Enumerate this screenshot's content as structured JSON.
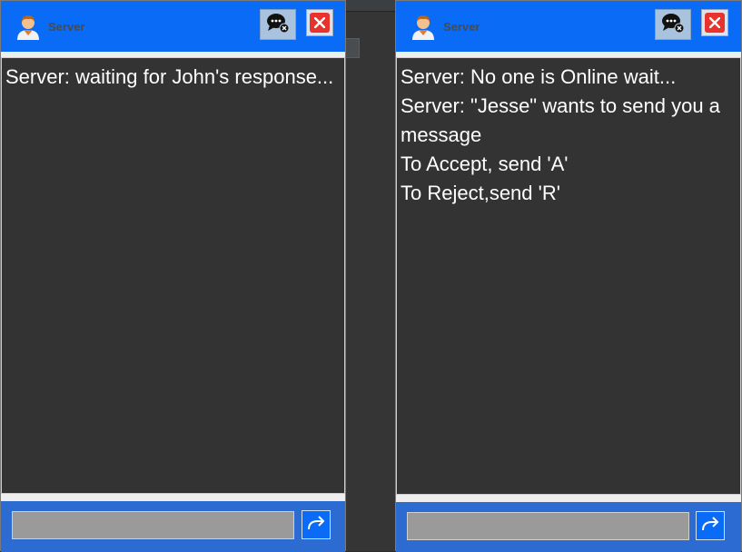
{
  "left_window": {
    "title": "Server",
    "messages": [
      "Server: waiting for John's response..."
    ],
    "input": {
      "value": "",
      "placeholder": ""
    }
  },
  "right_window": {
    "title": "Server",
    "messages": [
      "Server: No one is Online wait...",
      "Server: \"Jesse\" wants to send you a message",
      "To Accept, send 'A'",
      "To Reject,send 'R'"
    ],
    "input": {
      "value": "",
      "placeholder": ""
    }
  },
  "icons": {
    "avatar": "user-avatar-icon",
    "chat": "chat-bubble-close-icon",
    "close": "close-icon",
    "send": "send-arrow-icon"
  },
  "colors": {
    "header": "#0a6cf6",
    "chat_bg": "#333333",
    "close": "#e8332d",
    "input_bg": "#9a9a9a"
  }
}
